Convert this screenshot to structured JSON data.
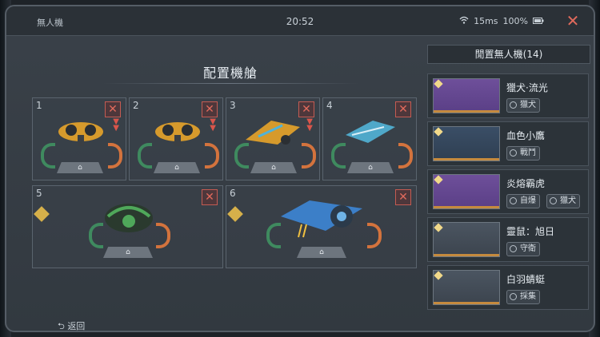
{
  "window": {
    "title": "無人機",
    "time": "20:52",
    "ping": "15ms",
    "battery": "100%",
    "close_icon": "close-icon"
  },
  "bay": {
    "title": "配置機艙"
  },
  "slots": [
    {
      "number": "1",
      "color": "#d69a2c"
    },
    {
      "number": "2",
      "color": "#d69a2c"
    },
    {
      "number": "3",
      "color": "#d69a2c"
    },
    {
      "number": "4",
      "color": "#4fa8c9"
    },
    {
      "number": "5",
      "color": "#4fa85a"
    },
    {
      "number": "6",
      "color": "#3c7fc8"
    }
  ],
  "idle": {
    "header": "閒置無人機(14)",
    "cards": [
      {
        "name": "獵犬·流光",
        "tags": [
          "獵犬"
        ]
      },
      {
        "name": "血色小鷹",
        "tags": [
          "戰鬥"
        ]
      },
      {
        "name": "炎熔霸虎",
        "tags": [
          "自爆",
          "獵犬"
        ]
      },
      {
        "name": "靈鼠：旭日",
        "tags": [
          "守衛"
        ]
      },
      {
        "name": "白羽蜻蜓",
        "tags": [
          "採集"
        ]
      }
    ]
  },
  "footer": {
    "back_label": "返回"
  }
}
